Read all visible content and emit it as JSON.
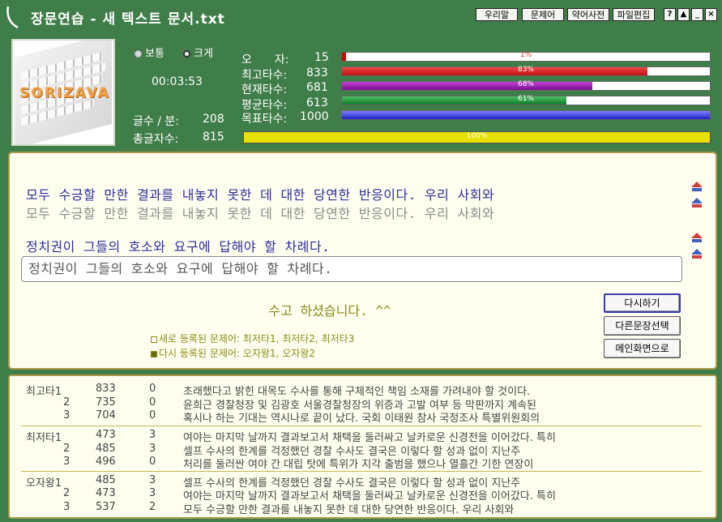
{
  "title": "장문연습 - 새 텍스트 문서.txt",
  "toolbar": {
    "btn_urimal": "우리말",
    "btn_mun": "문제어",
    "btn_abbr": "약어사전",
    "btn_file": "파일편집",
    "help": "?",
    "up": "▲",
    "min": "_",
    "close": "×"
  },
  "logo_text": "SORIZAVA",
  "size_options": {
    "normal": "보통",
    "large": "크게",
    "selected": "large"
  },
  "timer": "00:03:53",
  "stats": {
    "chars_per_min_label": "글수 / 분:",
    "chars_per_min": "208",
    "total_chars_label": "총글자수:",
    "total_chars": "815",
    "typo_label": "오　　자:",
    "typo": "15",
    "typo_pct_text": "1%",
    "typo_pct": 0.01,
    "max_label": "최고타수:",
    "max": "833",
    "max_pct_text": "83%",
    "max_pct": 0.83,
    "cur_label": "현재타수:",
    "cur": "681",
    "cur_pct_text": "68%",
    "cur_pct": 0.68,
    "avg_label": "평균타수:",
    "avg": "613",
    "avg_pct_text": "61%",
    "avg_pct": 0.61,
    "goal_label": "목표타수:",
    "goal": "1000",
    "goal_pct": 1.0,
    "total_progress_text": "100%",
    "total_progress": 1.0
  },
  "practice": {
    "line1_target": "모두 수긍할 만한 결과를 내놓지 못한 데 대한 당연한 반응이다. 우리 사회와",
    "line1_typed": "모두 수긍할 만한 결과를 내놓지 못한 데 대한 당연한 반응이다. 우리 사회와",
    "line2_target": "정치권이 그들의 호소와 요구에 답해야 할 차례다.",
    "line2_typed": "정치권이 그들의 호소와 요구에 답해야 할 차례다.",
    "done_message": "수고 하셨습니다. ^^",
    "new_words": "새로 등록된 문제어: 최저타1, 최저타2, 최저타3",
    "again_words": "다시 등록된 문제어: 오자왕1, 오자왕2",
    "btn_retry": "다시하기",
    "btn_other": "다른문장선택",
    "btn_main": "메인화면으로"
  },
  "records": [
    {
      "cat": "최고타1",
      "rank": "",
      "speed": "833",
      "err": "0",
      "text": "초래했다고 밝힌 대목도 수사를 통해 구체적인 책임 소재를 가려내야 할 것이다."
    },
    {
      "cat": "",
      "rank": "2",
      "speed": "735",
      "err": "0",
      "text": "윤희근 경찰청장 및 김광호 서울경찰청장의 위증과 고발 여부 등 막판까지 계속된"
    },
    {
      "cat": "",
      "rank": "3",
      "speed": "704",
      "err": "0",
      "text": "혹시나 하는 기대는 역시나로 끝이 났다. 국회 이태원 참사 국정조사 특별위원회의"
    },
    {
      "cat": "최저타1",
      "rank": "",
      "speed": "473",
      "err": "3",
      "text": "여야는 마지막 날까지 결과보고서 채택을 둘러싸고 날카로운 신경전을 이어갔다. 특히"
    },
    {
      "cat": "",
      "rank": "2",
      "speed": "485",
      "err": "3",
      "text": "셀프 수사의 한계를 걱정했던 경찰 수사도 결국은 이렇다 할 성과 없이 지난주"
    },
    {
      "cat": "",
      "rank": "3",
      "speed": "496",
      "err": "0",
      "text": "처리를 둘러싼 여야 간 대립 탓에 특위가 지각 출범을 했으나 열흘간 기한 연장이"
    },
    {
      "cat": "오자왕1",
      "rank": "",
      "speed": "485",
      "err": "3",
      "text": "셀프 수사의 한계를 걱정했던 경찰 수사도 결국은 이렇다 할 성과 없이 지난주"
    },
    {
      "cat": "",
      "rank": "2",
      "speed": "473",
      "err": "3",
      "text": "여야는 마지막 날까지 결과보고서 채택을 둘러싸고 날카로운 신경전을 이어갔다. 특히"
    },
    {
      "cat": "",
      "rank": "3",
      "speed": "537",
      "err": "2",
      "text": "모두 수긍할 만한 결과를 내놓지 못한 데 대한 당연한 반응이다. 우리 사회와"
    }
  ]
}
